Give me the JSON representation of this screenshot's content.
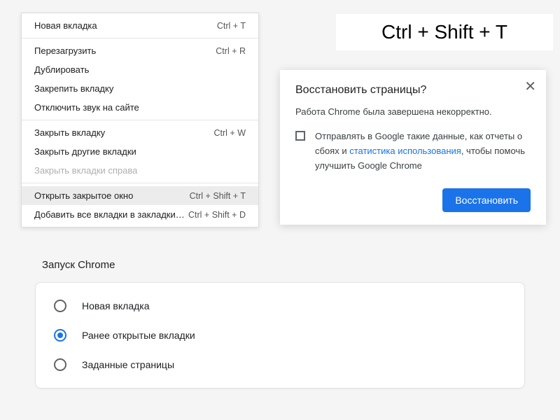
{
  "context_menu": {
    "section1": [
      {
        "label": "Новая вкладка",
        "shortcut": "Ctrl + T"
      }
    ],
    "section2": [
      {
        "label": "Перезагрузить",
        "shortcut": "Ctrl + R"
      },
      {
        "label": "Дублировать",
        "shortcut": ""
      },
      {
        "label": "Закрепить вкладку",
        "shortcut": ""
      },
      {
        "label": "Отключить звук на сайте",
        "shortcut": ""
      }
    ],
    "section3": [
      {
        "label": "Закрыть вкладку",
        "shortcut": "Ctrl + W"
      },
      {
        "label": "Закрыть другие вкладки",
        "shortcut": ""
      },
      {
        "label": "Закрыть вкладки справа",
        "shortcut": "",
        "disabled": true
      }
    ],
    "section4": [
      {
        "label": "Открыть закрытое окно",
        "shortcut": "Ctrl + Shift + T",
        "highlighted": true
      },
      {
        "label": "Добавить все вкладки в закладки…",
        "shortcut": "Ctrl + Shift + D"
      }
    ]
  },
  "big_shortcut": "Ctrl + Shift + T",
  "dialog": {
    "title": "Восстановить страницы?",
    "subtitle": "Работа Chrome была завершена некорректно.",
    "checkbox_text_pre": "Отправлять в Google такие данные, как отчеты о сбоях и ",
    "checkbox_link": "статистика использования",
    "checkbox_text_post": ", чтобы помочь улучшить Google Chrome",
    "button": "Восстановить"
  },
  "settings": {
    "heading": "Запуск Chrome",
    "options": [
      {
        "label": "Новая вкладка",
        "selected": false
      },
      {
        "label": "Ранее открытые вкладки",
        "selected": true
      },
      {
        "label": "Заданные страницы",
        "selected": false
      }
    ]
  }
}
